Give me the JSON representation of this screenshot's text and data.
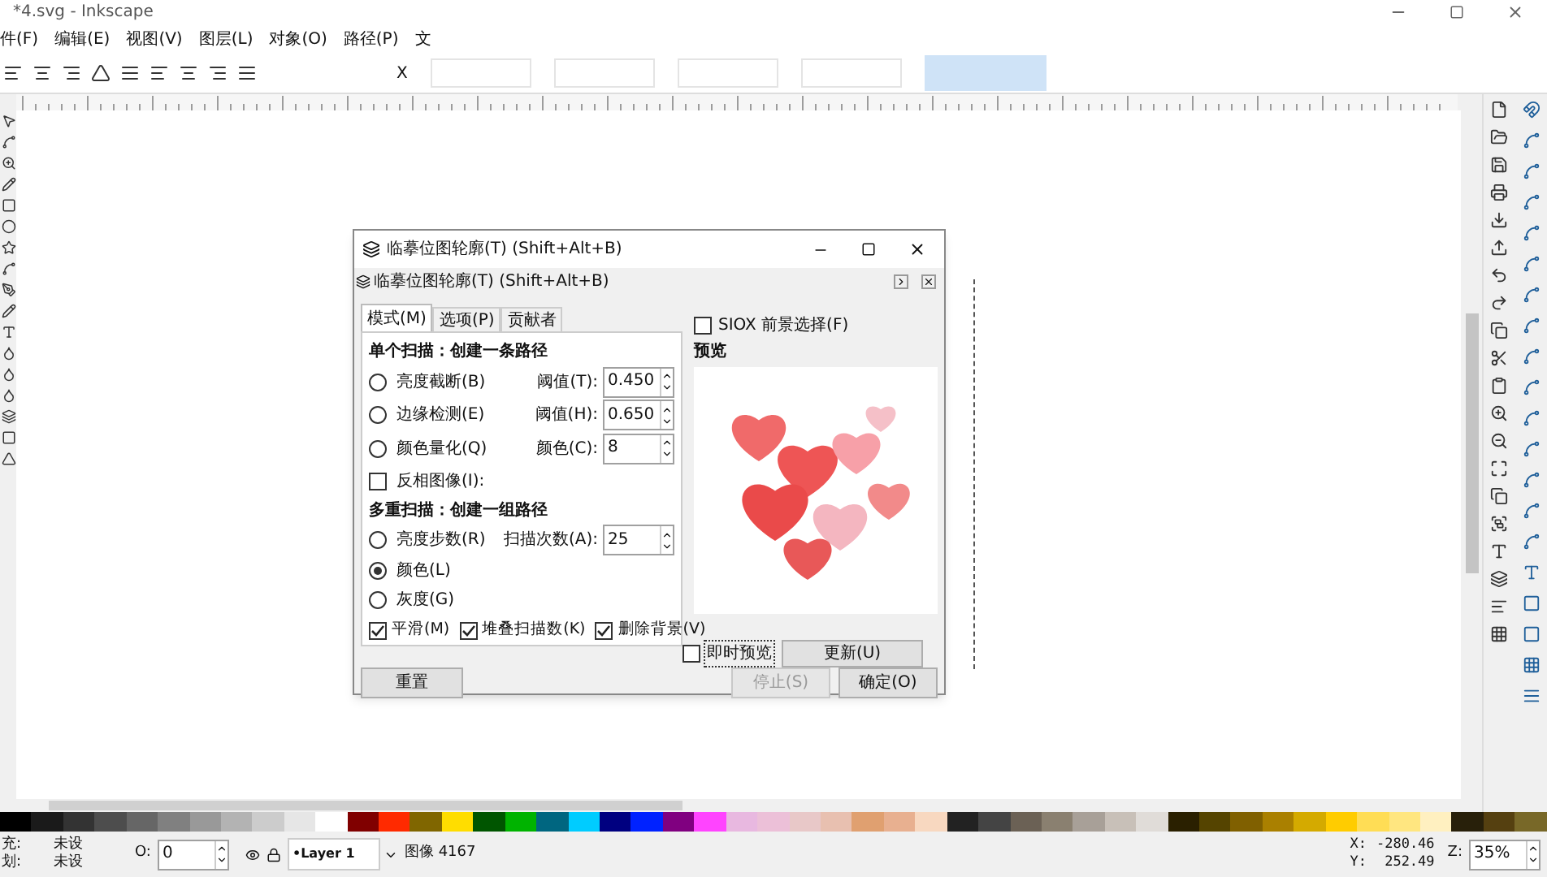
{
  "window": {
    "title": "*4.svg - Inkscape"
  },
  "menu": [
    "件(F)",
    "编辑(E)",
    "视图(V)",
    "图层(L)",
    "对象(O)",
    "路径(P)",
    "文"
  ],
  "toolbar": {
    "x_label": "X"
  },
  "dialog": {
    "title": "临摹位图轮廓(T) (Shift+Alt+B)",
    "panel_title": "临摹位图轮廓(T) (Shift+Alt+B)",
    "tabs": [
      {
        "label": "模式(M)",
        "selected": true
      },
      {
        "label": "选项(P)",
        "selected": false
      },
      {
        "label": "贡献者",
        "selected": false
      }
    ],
    "single_heading": "单个扫描：创建一条路径",
    "single_options": [
      {
        "label": "亮度截断(B)",
        "selected": false,
        "field_label": "阈值(T):",
        "field_value": "0.450"
      },
      {
        "label": "边缘检测(E)",
        "selected": false,
        "field_label": "阈值(H):",
        "field_value": "0.650"
      },
      {
        "label": "颜色量化(Q)",
        "selected": false,
        "field_label": "颜色(C):",
        "field_value": "8"
      }
    ],
    "invert": {
      "label": "反相图像(I):",
      "checked": false
    },
    "multi_heading": "多重扫描：创建一组路径",
    "multi_options": [
      {
        "label": "亮度步数(R)",
        "selected": false
      },
      {
        "label": "颜色(L)",
        "selected": true
      },
      {
        "label": "灰度(G)",
        "selected": false
      }
    ],
    "scans": {
      "label": "扫描次数(A):",
      "value": "25"
    },
    "checks": [
      {
        "label": "平滑(M)",
        "checked": true
      },
      {
        "label": "堆叠扫描数(K)",
        "checked": true
      },
      {
        "label": "删除背景(V)",
        "checked": true
      }
    ],
    "siox": {
      "label": "SIOX 前景选择(F)",
      "checked": false
    },
    "preview_label": "预览",
    "live_preview": {
      "label": "即时预览",
      "checked": false
    },
    "update_button": "更新(U)",
    "reset_button": "重置",
    "buttons": [
      {
        "label": "停止(S)",
        "disabled": true
      },
      {
        "label": "确定(O)",
        "disabled": false
      }
    ]
  },
  "palette": [
    {
      "color": "#000000"
    },
    {
      "color": "#1a1a1a"
    },
    {
      "color": "#333333"
    },
    {
      "color": "#4d4d4d"
    },
    {
      "color": "#666666"
    },
    {
      "color": "#808080"
    },
    {
      "color": "#999999"
    },
    {
      "color": "#b3b3b3"
    },
    {
      "color": "#cccccc"
    },
    {
      "color": "#e6e6e6"
    },
    {
      "color": "#ffffff"
    },
    {
      "color": "#800000"
    },
    {
      "color": "#ff2a00"
    },
    {
      "color": "#806600"
    },
    {
      "color": "#ffdd00"
    },
    {
      "color": "#005500"
    },
    {
      "color": "#00b300"
    },
    {
      "color": "#006680"
    },
    {
      "color": "#00ccff"
    },
    {
      "color": "#000080"
    },
    {
      "color": "#0022ff"
    },
    {
      "color": "#800080"
    },
    {
      "color": "#ff44ff"
    },
    {
      "color": "#e8b8e0"
    },
    {
      "color": "#ecc0d8"
    },
    {
      "color": "#e8c8c8"
    },
    {
      "color": "#e8c0b0"
    },
    {
      "color": "#e0a070"
    },
    {
      "color": "#e8b090"
    },
    {
      "color": "#f8d8c0"
    },
    {
      "color": "#222222"
    },
    {
      "color": "#444444"
    },
    {
      "color": "#6b6155"
    },
    {
      "color": "#8a8070"
    },
    {
      "color": "#a8a098"
    },
    {
      "color": "#c8c0b8"
    },
    {
      "color": "#e0dcd8"
    },
    {
      "color": "#2a2000"
    },
    {
      "color": "#554400"
    },
    {
      "color": "#806000"
    },
    {
      "color": "#aa8000"
    },
    {
      "color": "#d4aa00"
    },
    {
      "color": "#ffcc00"
    },
    {
      "color": "#ffdd55"
    },
    {
      "color": "#ffe680"
    },
    {
      "color": "#fff0c0"
    },
    {
      "color": "#28200a"
    },
    {
      "color": "#554010"
    },
    {
      "color": "#786828"
    }
  ],
  "status": {
    "fill_label": "充:",
    "fill_value": "未设",
    "stroke_label": "划:",
    "stroke_value": "未设",
    "opacity_label": "O:",
    "opacity_value": "0",
    "layer": "•Layer 1",
    "message": "图像 4167",
    "x_label": "X:",
    "x_value": "-280.46",
    "y_label": "Y:",
    "y_value": "252.49",
    "zoom_label": "Z:",
    "zoom_value": "35%"
  }
}
